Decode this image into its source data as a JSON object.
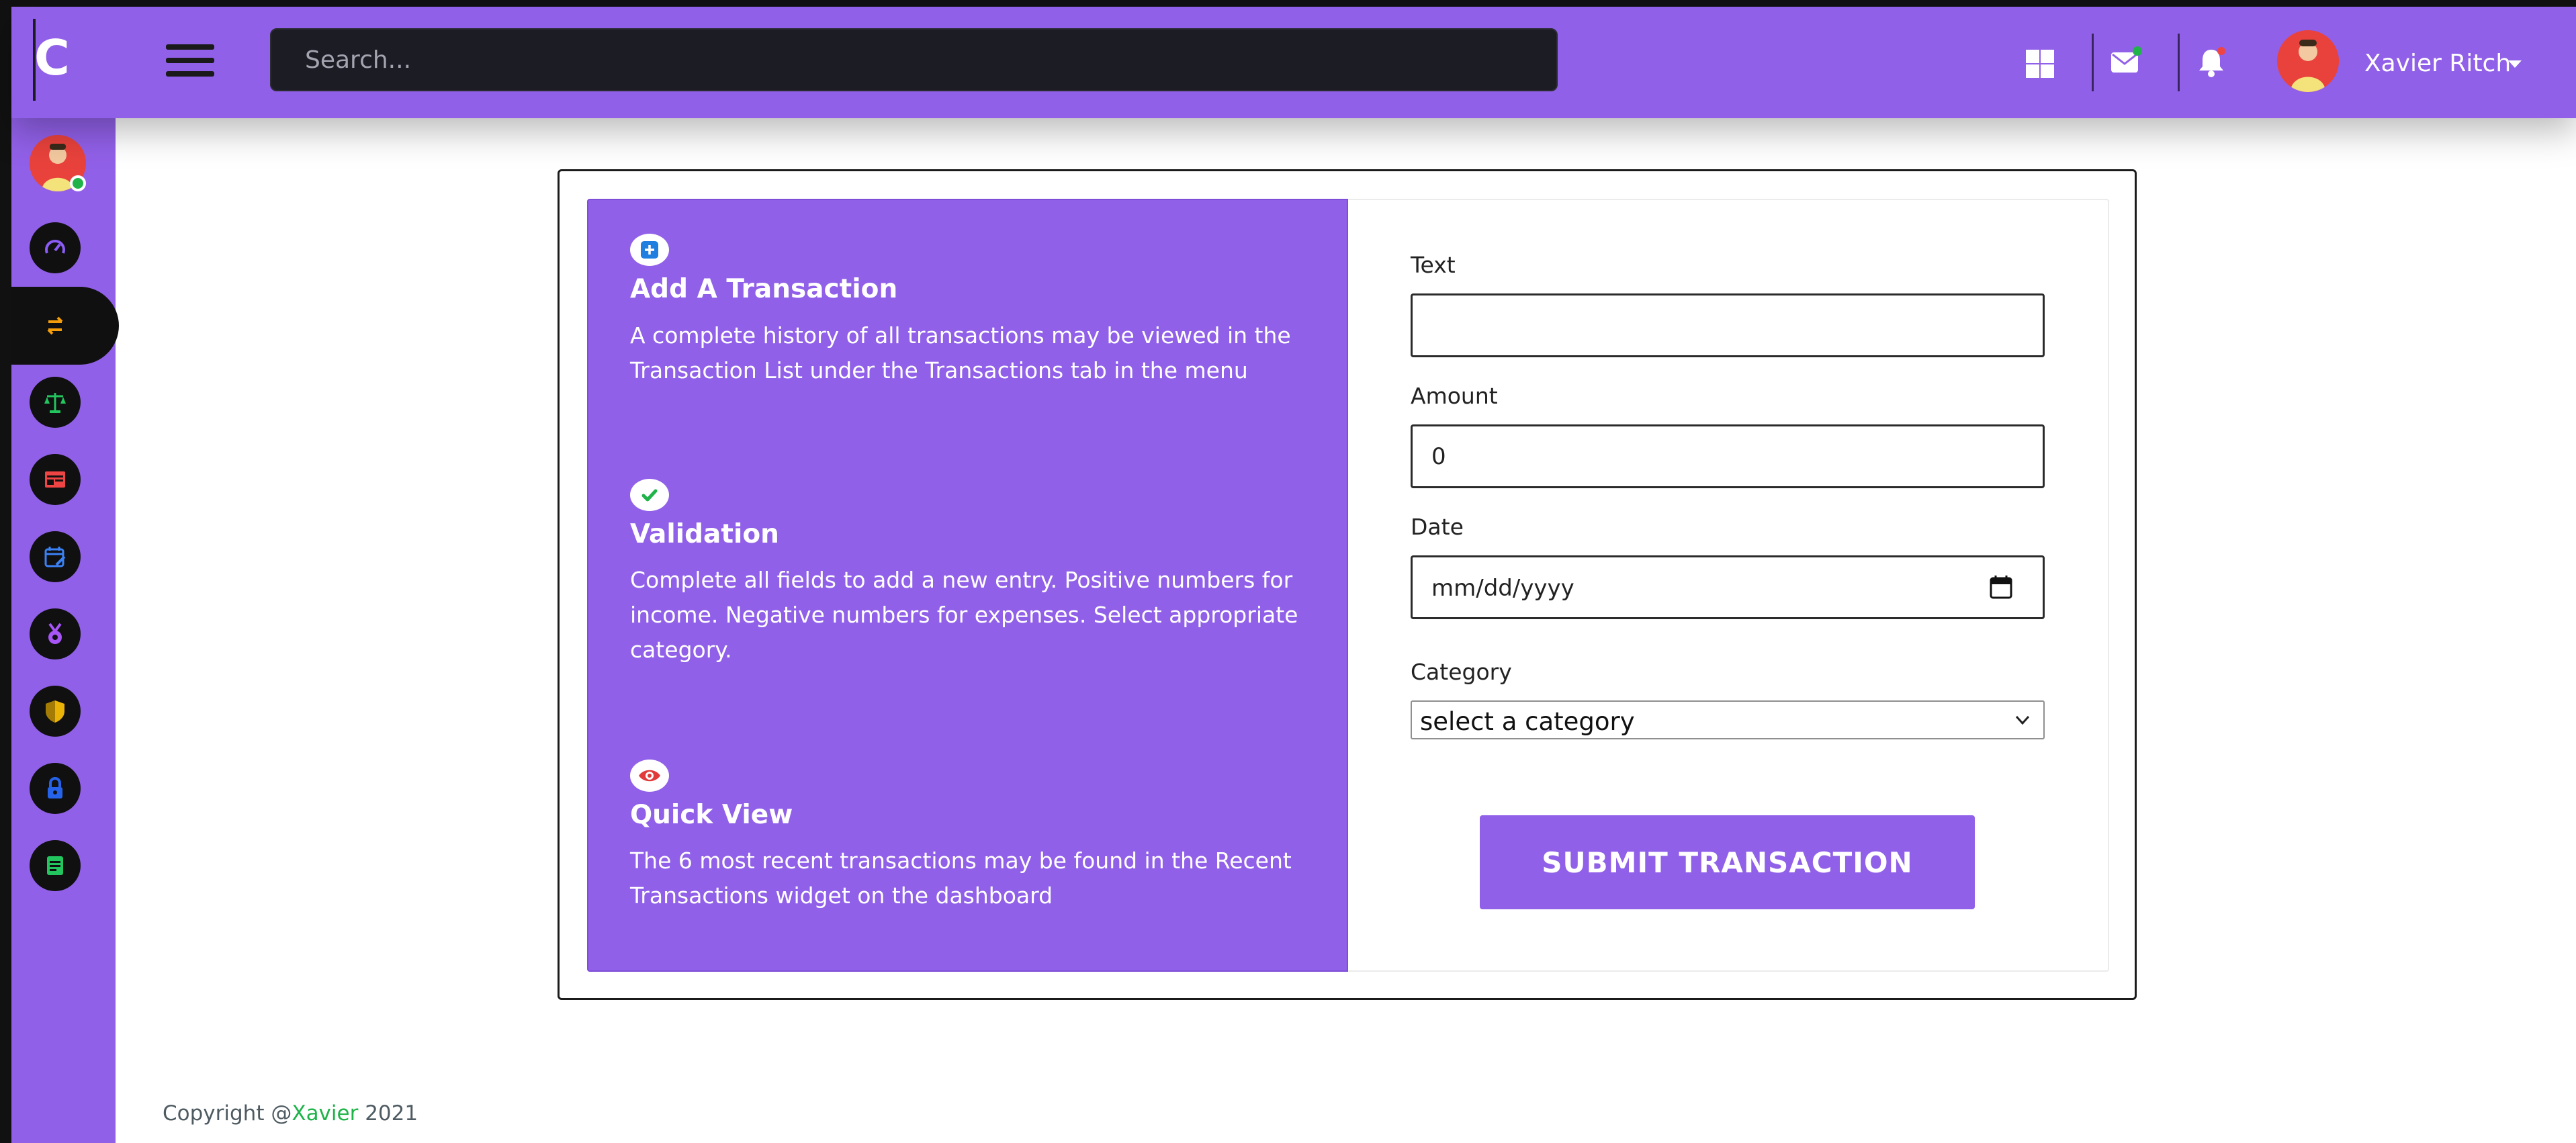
{
  "app": {
    "logo_letter": "C",
    "brand_color": "#9160e8"
  },
  "header": {
    "search_placeholder": "Search...",
    "icons": [
      "menu-icon",
      "grid-icon",
      "mail-icon",
      "bell-icon"
    ],
    "user_name": "Xavier Ritch"
  },
  "sidebar": {
    "items": [
      {
        "name": "dashboard-icon",
        "color": "#8b5cf6"
      },
      {
        "name": "transactions-icon",
        "color": "#f59e0b",
        "active": true
      },
      {
        "name": "balance-icon",
        "color": "#22c55e"
      },
      {
        "name": "budget-icon",
        "color": "#ef4444"
      },
      {
        "name": "calendar-icon",
        "color": "#3b82f6"
      },
      {
        "name": "badge-icon",
        "color": "#a855f7"
      },
      {
        "name": "shield-icon",
        "color": "#eab308"
      },
      {
        "name": "lock-icon",
        "color": "#2563eb"
      },
      {
        "name": "notes-icon",
        "color": "#22c55e"
      }
    ]
  },
  "info_panel": {
    "features": [
      {
        "title": "Add A Transaction",
        "text": "A complete history of all transactions may be viewed in the Transaction List under the Transactions tab in the menu"
      },
      {
        "title": "Validation",
        "text": "Complete all fields to add a new entry. Positive numbers for income. Negative numbers for expenses. Select appropriate category."
      },
      {
        "title": "Quick View",
        "text": "The 6 most recent transactions may be found in the Recent Transactions widget on the dashboard"
      }
    ]
  },
  "form": {
    "text_label": "Text",
    "text_value": "",
    "amount_label": "Amount",
    "amount_value": "0",
    "date_label": "Date",
    "date_placeholder": "mm/dd/yyyy",
    "category_label": "Category",
    "category_value": "select a category",
    "submit_label": "SUBMIT TRANSACTION"
  },
  "footer": {
    "prefix": "Copyright @",
    "brand": "Xavier",
    "year": " 2021"
  }
}
